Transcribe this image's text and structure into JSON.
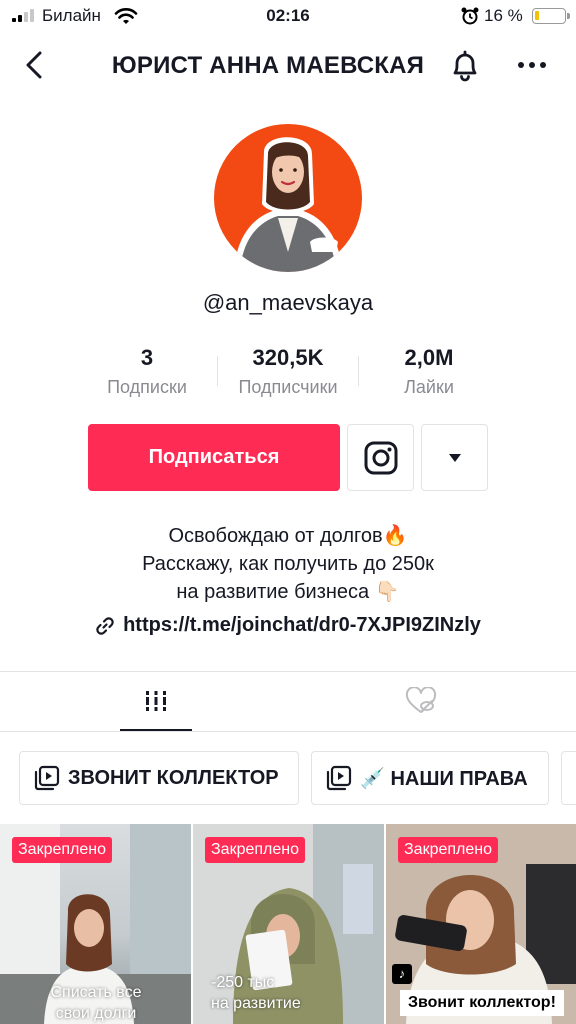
{
  "status_bar": {
    "carrier": "Билайн",
    "time": "02:16",
    "battery_percent": "16 %",
    "battery_level": 0.16
  },
  "header": {
    "title": "ЮРИСТ АННА МАЕВСКАЯ"
  },
  "profile": {
    "username": "@an_maevskaya",
    "stats": [
      {
        "value": "3",
        "label": "Подписки"
      },
      {
        "value": "320,5K",
        "label": "Подписчики"
      },
      {
        "value": "2,0M",
        "label": "Лайки"
      }
    ],
    "follow_label": "Подписаться",
    "bio_lines": [
      "Освобождаю от долгов🔥",
      "Расскажу, как получить до 250к",
      "на развитие бизнеса 👇🏻"
    ],
    "link": "https://t.me/joinchat/dr0-7XJPI9ZINzly"
  },
  "playlists": [
    {
      "label": "ЗВОНИТ КОЛЛЕКТОР"
    },
    {
      "label": "💉 НАШИ ПРАВА"
    }
  ],
  "videos": [
    {
      "badge": "Закреплено",
      "caption": "Списать все\nсвои долги"
    },
    {
      "badge": "Закреплено",
      "caption": "-250 тыс\nна развитие"
    },
    {
      "badge": "Закреплено",
      "caption": "Звонит коллектор!"
    }
  ],
  "colors": {
    "accent": "#fe2c55",
    "avatar_bg": "#f24a12",
    "battery": "#f2c200"
  }
}
